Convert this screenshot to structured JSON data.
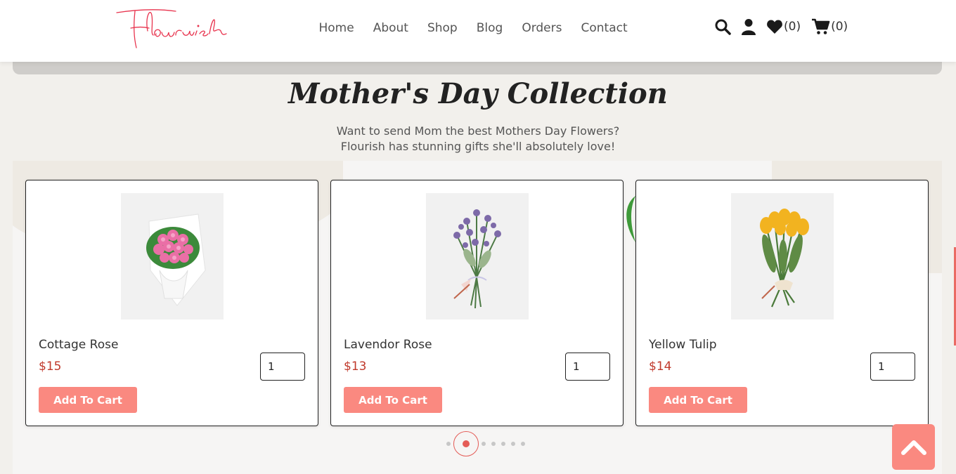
{
  "brand": {
    "logo_text": "Flourish"
  },
  "nav": {
    "items": [
      "Home",
      "About",
      "Shop",
      "Blog",
      "Orders",
      "Contact"
    ]
  },
  "header_icons": {
    "search": "search-icon",
    "user": "user-icon",
    "wishlist": "heart-icon",
    "wishlist_count": "(0)",
    "cart": "cart-icon",
    "cart_count": "(0)"
  },
  "section": {
    "title": "Mother's Day Collection",
    "subtitle_line1": "Want to send Mom the best Mothers Day Flowers?",
    "subtitle_line2": "Flourish has stunning gifts she'll absolutely love!"
  },
  "products": [
    {
      "name": "Cottage Rose",
      "price": "$15",
      "qty": "1",
      "button": "Add To Cart"
    },
    {
      "name": "Lavendor Rose",
      "price": "$13",
      "qty": "1",
      "button": "Add To Cart"
    },
    {
      "name": "Yellow Tulip",
      "price": "$14",
      "qty": "1",
      "button": "Add To Cart"
    }
  ],
  "pagination": {
    "total": 7,
    "active": 2
  },
  "colors": {
    "accent": "#fa8980",
    "price": "#c0392b",
    "logo": "#e8344e",
    "active_dot": "#e45c57"
  }
}
